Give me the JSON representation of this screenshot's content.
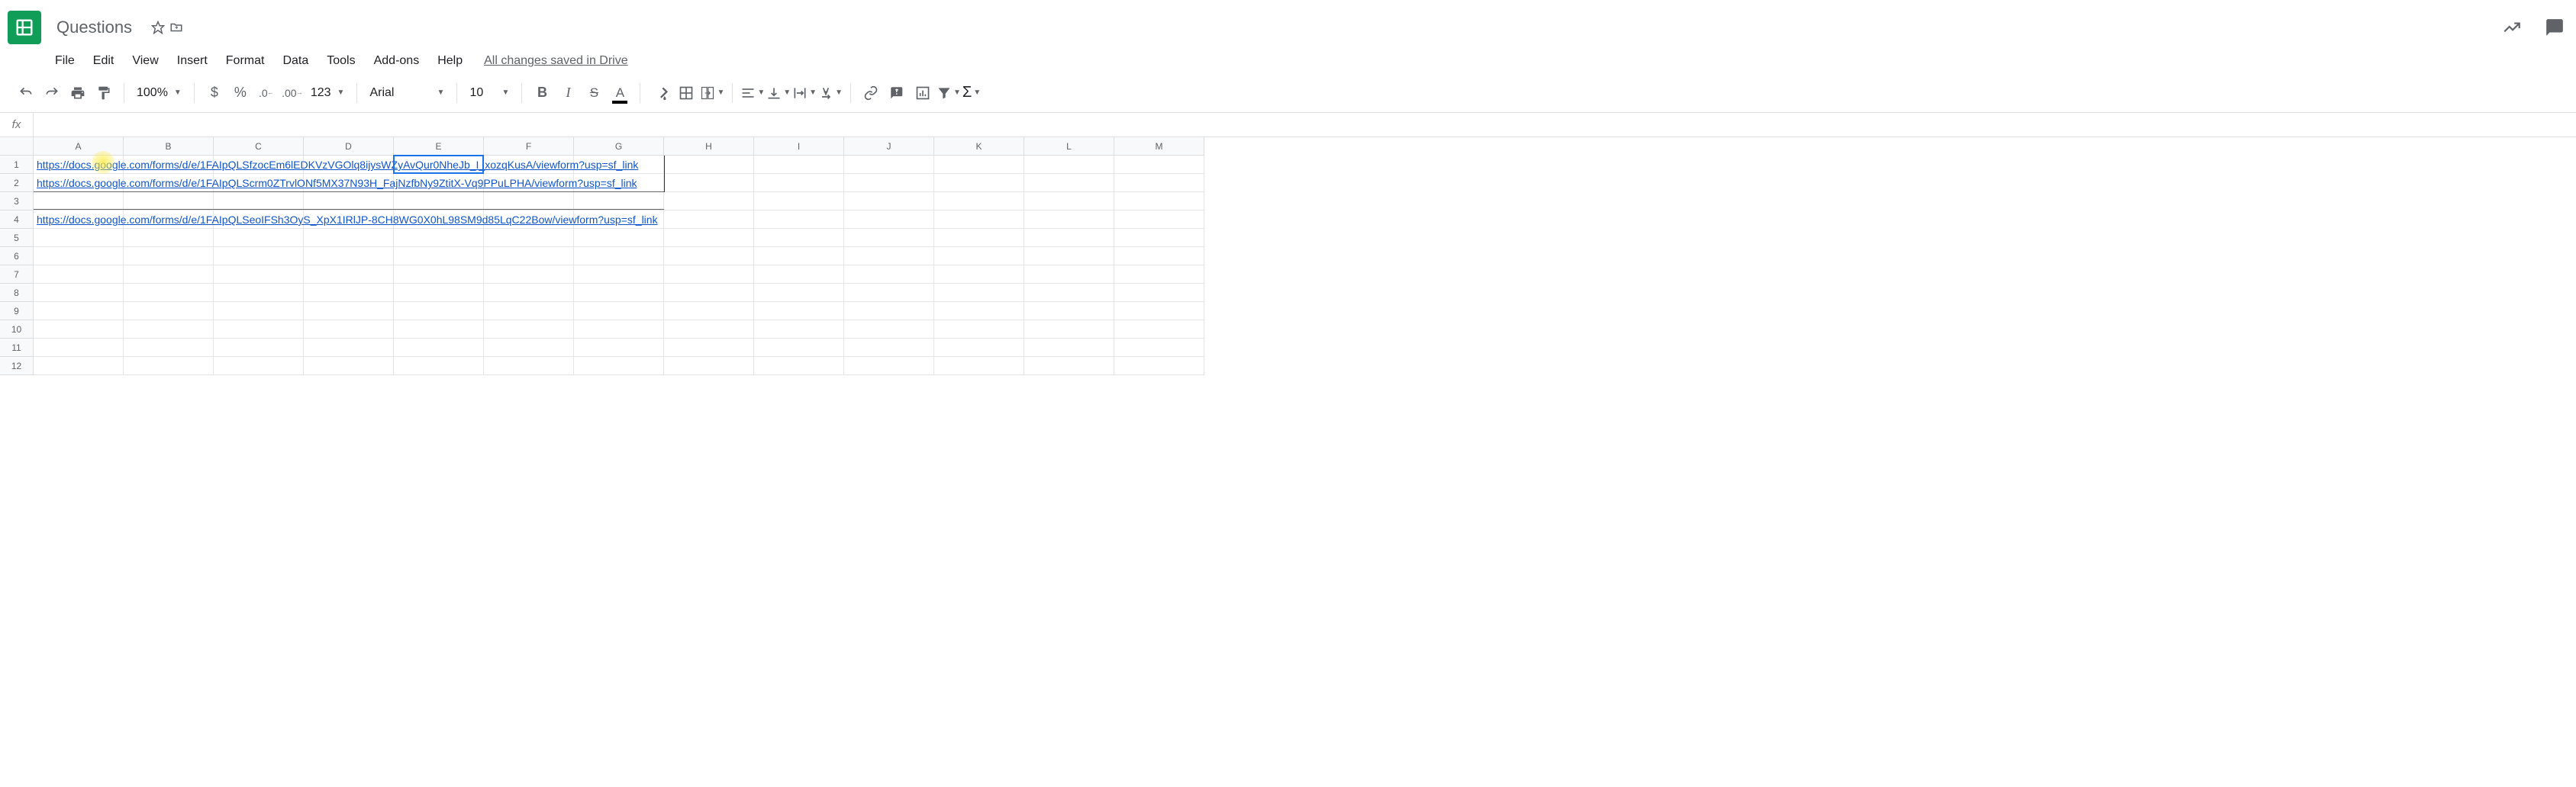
{
  "app": {
    "title": "Questions",
    "save_status": "All changes saved in Drive"
  },
  "menus": [
    "File",
    "Edit",
    "View",
    "Insert",
    "Format",
    "Data",
    "Tools",
    "Add-ons",
    "Help"
  ],
  "toolbar": {
    "zoom": "100%",
    "font": "Arial",
    "font_size": "10",
    "more_formats": "123"
  },
  "formula_bar": {
    "fx_label": "fx",
    "value": ""
  },
  "grid": {
    "columns": [
      "A",
      "B",
      "C",
      "D",
      "E",
      "F",
      "G",
      "H",
      "I",
      "J",
      "K",
      "L",
      "M"
    ],
    "rows": [
      "1",
      "2",
      "3",
      "4",
      "5",
      "6",
      "7",
      "8",
      "9",
      "10",
      "11",
      "12"
    ],
    "active_cell": "E1",
    "data": {
      "A1": "https://docs.google.com/forms/d/e/1FAIpQLSfzocEm6lEDKVzVGOlq8ijysWZyAvQur0NheJb_I_xozqKusA/viewform?usp=sf_link",
      "A2": "https://docs.google.com/forms/d/e/1FAIpQLScrm0ZTrvlONf5MX37N93H_FajNzfbNy9ZtitX-Vq9PPuLPHA/viewform?usp=sf_link",
      "A4": "https://docs.google.com/forms/d/e/1FAIpQLSeoIFSh3OyS_XpX1IRlJP-8CH8WG0X0hL98SM9d85LqC22Bow/viewform?usp=sf_link"
    }
  }
}
